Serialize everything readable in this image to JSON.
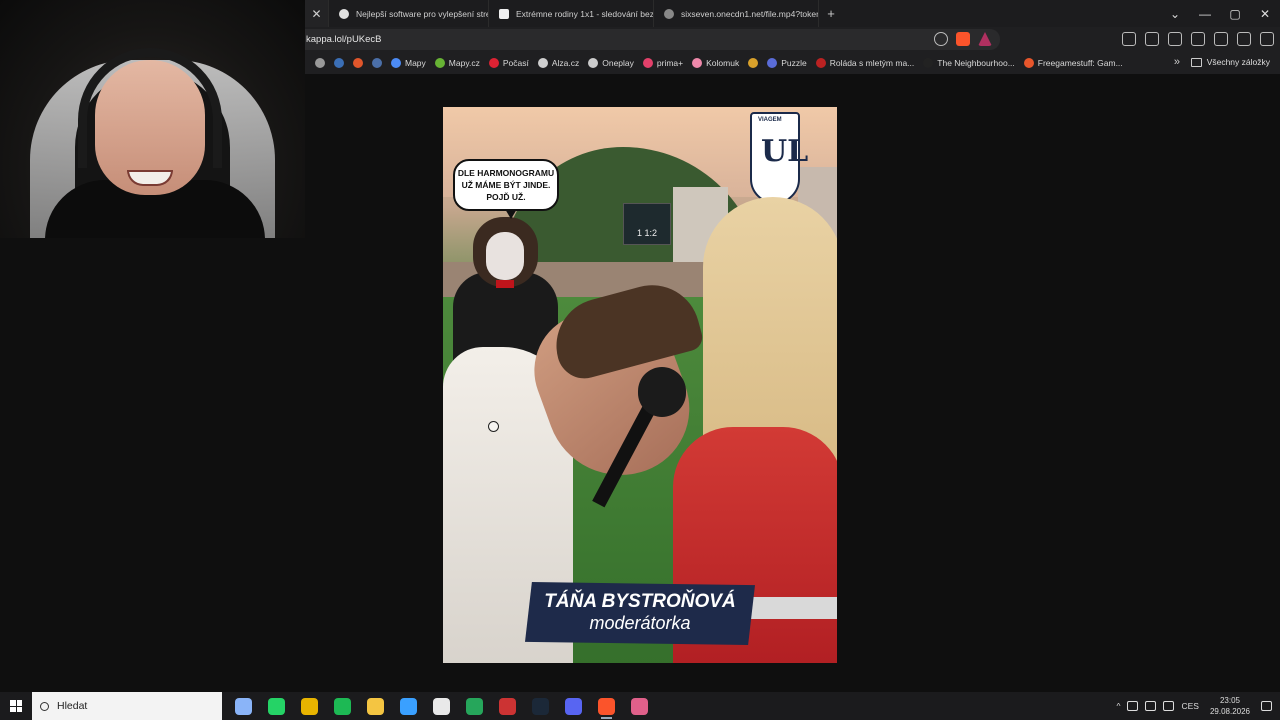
{
  "tabs": [
    {
      "label": "",
      "icon": "close"
    },
    {
      "label": "Nejlepší software pro vylepšení strea",
      "icon": "brave",
      "color": "#e0e0e0"
    },
    {
      "label": "Extrémne rodiny 1x1 - sledování bez",
      "icon": "h-site",
      "color": "#f0f0f0"
    },
    {
      "label": "sixseven.onecdn1.net/file.mp4?token",
      "icon": "globe",
      "color": "#888"
    }
  ],
  "newtab": "+",
  "window_controls": {
    "dropdown": "⌄",
    "minimize": "—",
    "maximize": "▢",
    "close": "✕"
  },
  "address": {
    "url": "kappa.lol/pUKecB"
  },
  "bookmarks": {
    "items": [
      {
        "label": "",
        "icon": "bookmark-c",
        "color": "#999"
      },
      {
        "label": "",
        "icon": "bookmark-h",
        "color": "#3b6fb6"
      },
      {
        "label": "",
        "icon": "bookmark-at",
        "color": "#e0562b"
      },
      {
        "label": "",
        "icon": "bookmark-arrow",
        "color": "#4b6fa8"
      },
      {
        "label": "Mapy",
        "icon": "map-pin",
        "color": "#4c8bf5"
      },
      {
        "label": "Mapy.cz",
        "icon": "mapy",
        "color": "#67b334"
      },
      {
        "label": "Počasí",
        "icon": "weather",
        "color": "#d23"
      },
      {
        "label": "Alza.cz",
        "icon": "alza",
        "color": "#cfcfcf"
      },
      {
        "label": "Oneplay",
        "icon": "oneplay",
        "color": "#ccc"
      },
      {
        "label": "prima+",
        "icon": "prima",
        "color": "#e2406a"
      },
      {
        "label": "Kolomuk",
        "icon": "kolomuk",
        "color": "#e8a"
      },
      {
        "label": "",
        "icon": "chrome",
        "color": "#d9a12b"
      },
      {
        "label": "Puzzle",
        "icon": "puzzle",
        "color": "#5a6cd8"
      },
      {
        "label": "Roláda s mletým ma...",
        "icon": "recipe",
        "color": "#b22"
      },
      {
        "label": "The Neighbourhoo...",
        "icon": "tm",
        "color": "#222"
      },
      {
        "label": "Freegamestuff: Gam...",
        "icon": "reddit",
        "color": "#e8562b"
      }
    ],
    "more": "»",
    "all_label": "Všechny záložky"
  },
  "photo": {
    "bubble": "DLE HARMONOGRAMU UŽ MÁME BÝT JINDE. POJĎ UŽ.",
    "score": "1 1:2",
    "crest_top": "VIAGEM",
    "crest_mark": "UL",
    "caption_name": "TÁŇA BYSTROŇOVÁ",
    "caption_role": "moderátorka"
  },
  "taskbar": {
    "search_placeholder": "Hledat",
    "apps": [
      {
        "icon": "task-view",
        "color": "#8ab4f8"
      },
      {
        "icon": "whatsapp",
        "color": "#25d366"
      },
      {
        "icon": "chrome",
        "color": "#e8b400"
      },
      {
        "icon": "spotify",
        "color": "#1db954"
      },
      {
        "icon": "file-explorer",
        "color": "#f4c542"
      },
      {
        "icon": "m-app",
        "color": "#3aa0ff"
      },
      {
        "icon": "g-app",
        "color": "#e9e9e9"
      },
      {
        "icon": "green-app",
        "color": "#26a65b"
      },
      {
        "icon": "app-red",
        "color": "#c33"
      },
      {
        "icon": "steam",
        "color": "#1b2838"
      },
      {
        "icon": "discord",
        "color": "#5865f2"
      },
      {
        "icon": "brave",
        "color": "#fb542b",
        "active": true
      },
      {
        "icon": "pin-app",
        "color": "#e0608a"
      }
    ],
    "tray": {
      "lang": "CES",
      "time": "23:05",
      "date": "29.08.2026",
      "chevron": "^"
    }
  },
  "colors": {
    "background": "#0f0f0f",
    "caption_bg": "#1e2a4a",
    "dress": "#c12b2b"
  }
}
